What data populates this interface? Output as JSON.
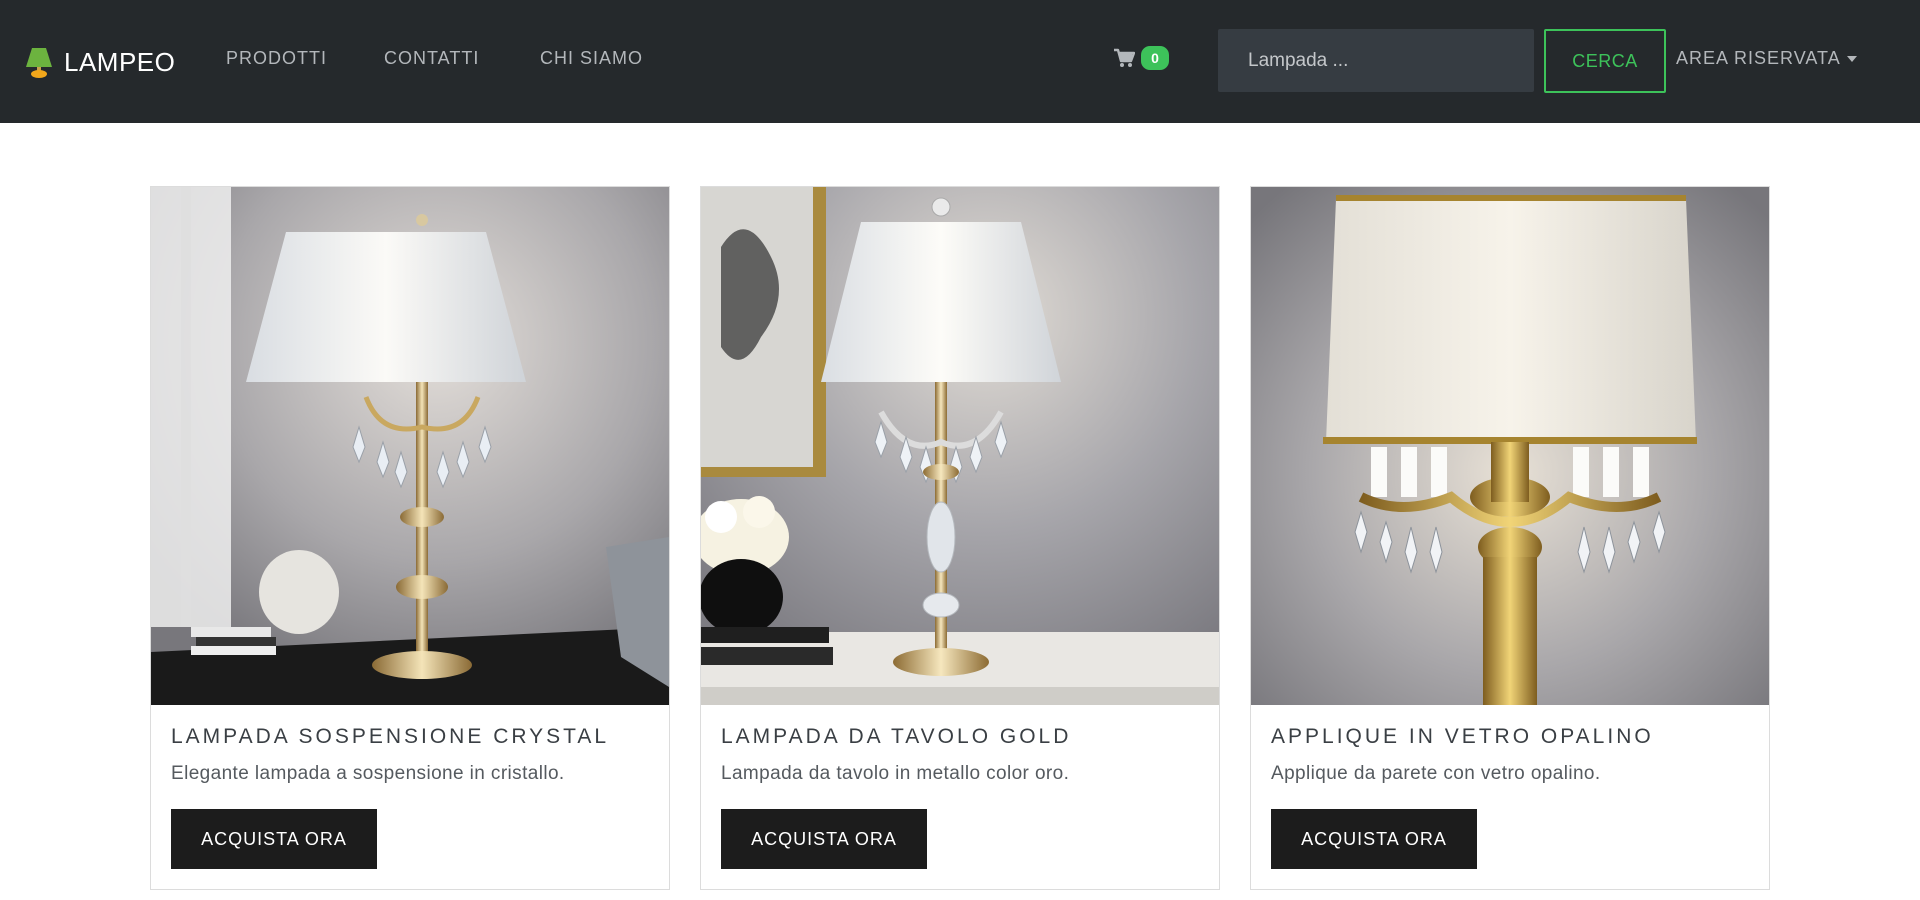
{
  "navbar": {
    "brand": "LAMPEO",
    "links": [
      "PRODOTTI",
      "CONTATTI",
      "CHI SIAMO"
    ],
    "cart_count": "0",
    "search_placeholder": "Lampada ...",
    "search_button": "CERCA",
    "user_menu": "AREA RISERVATA"
  },
  "colors": {
    "navbar_bg": "#25292c",
    "accent_green": "#3dc25a",
    "button_dark": "#1c1c1c"
  },
  "products": [
    {
      "title": "LAMPADA SOSPENSIONE CRYSTAL",
      "description": "Elegante lampada a sospensione in cristallo.",
      "button": "ACQUISTA ORA"
    },
    {
      "title": "LAMPADA DA TAVOLO GOLD",
      "description": "Lampada da tavolo in metallo color oro.",
      "button": "ACQUISTA ORA"
    },
    {
      "title": "APPLIQUE IN VETRO OPALINO",
      "description": "Applique da parete con vetro opalino.",
      "button": "ACQUISTA ORA"
    }
  ]
}
